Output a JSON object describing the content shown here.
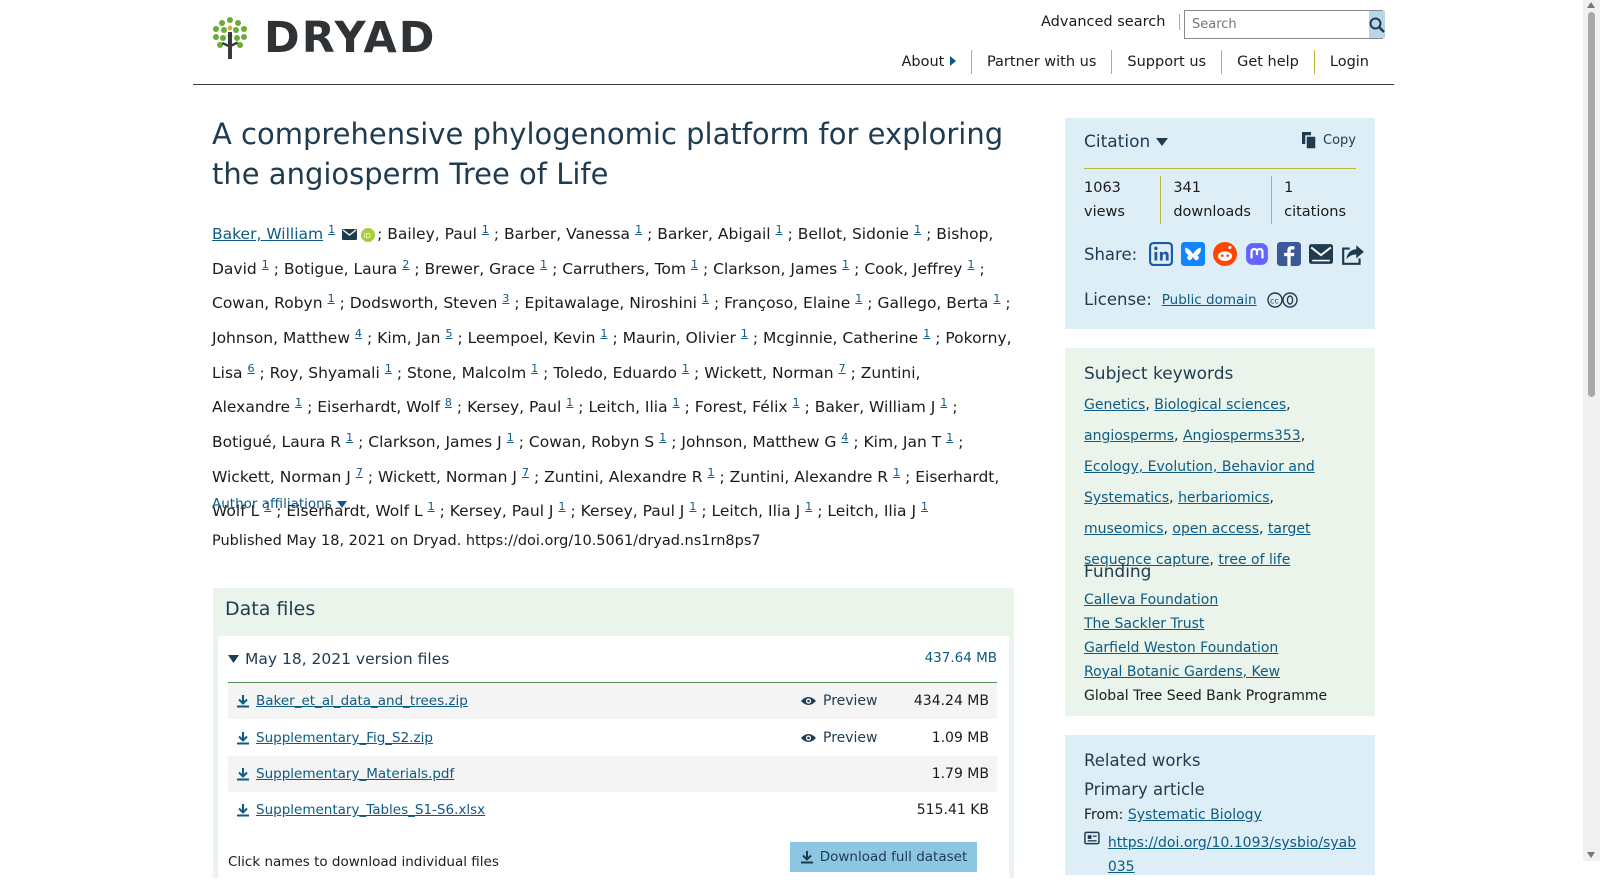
{
  "header": {
    "logo_text": "DRYAD",
    "advanced_search": "Advanced search",
    "search_placeholder": "Search",
    "nav": [
      "About",
      "Partner with us",
      "Support us",
      "Get help",
      "Login"
    ]
  },
  "dataset": {
    "title": "A comprehensive phylogenomic platform for exploring the angiosperm Tree of Life",
    "authors": [
      {
        "name": "Baker, William",
        "aff": "1"
      },
      {
        "name": "Bailey, Paul",
        "aff": "1"
      },
      {
        "name": "Barber, Vanessa",
        "aff": "1"
      },
      {
        "name": "Barker, Abigail",
        "aff": "1"
      },
      {
        "name": "Bellot, Sidonie",
        "aff": "1"
      },
      {
        "name": "Bishop, David",
        "aff": "1"
      },
      {
        "name": "Botigue, Laura",
        "aff": "2"
      },
      {
        "name": "Brewer, Grace",
        "aff": "1"
      },
      {
        "name": "Carruthers, Tom",
        "aff": "1"
      },
      {
        "name": "Clarkson, James",
        "aff": "1"
      },
      {
        "name": "Cook, Jeffrey",
        "aff": "1"
      },
      {
        "name": "Cowan, Robyn",
        "aff": "1"
      },
      {
        "name": "Dodsworth, Steven",
        "aff": "3"
      },
      {
        "name": "Epitawalage, Niroshini",
        "aff": "1"
      },
      {
        "name": "Françoso, Elaine",
        "aff": "1"
      },
      {
        "name": "Gallego, Berta",
        "aff": "1"
      },
      {
        "name": "Johnson, Matthew",
        "aff": "4"
      },
      {
        "name": "Kim, Jan",
        "aff": "5"
      },
      {
        "name": "Leempoel, Kevin",
        "aff": "1"
      },
      {
        "name": "Maurin, Olivier",
        "aff": "1"
      },
      {
        "name": "Mcginnie, Catherine",
        "aff": "1"
      },
      {
        "name": "Pokorny, Lisa",
        "aff": "6"
      },
      {
        "name": "Roy, Shyamali",
        "aff": "1"
      },
      {
        "name": "Stone, Malcolm",
        "aff": "1"
      },
      {
        "name": "Toledo, Eduardo",
        "aff": "1"
      },
      {
        "name": "Wickett, Norman",
        "aff": "7"
      },
      {
        "name": "Zuntini, Alexandre",
        "aff": "1"
      },
      {
        "name": "Eiserhardt, Wolf",
        "aff": "8"
      },
      {
        "name": "Kersey, Paul",
        "aff": "1"
      },
      {
        "name": "Leitch, Ilia",
        "aff": "1"
      },
      {
        "name": "Forest, Félix",
        "aff": "1"
      },
      {
        "name": "Baker, William J",
        "aff": "1"
      },
      {
        "name": "Botigué, Laura R",
        "aff": "1"
      },
      {
        "name": "Clarkson, James J",
        "aff": "1"
      },
      {
        "name": "Cowan, Robyn S",
        "aff": "1"
      },
      {
        "name": "Johnson, Matthew G",
        "aff": "4"
      },
      {
        "name": "Kim, Jan T",
        "aff": "1"
      },
      {
        "name": "Wickett, Norman J",
        "aff": "7"
      },
      {
        "name": "Wickett, Norman J",
        "aff": "7"
      },
      {
        "name": "Zuntini, Alexandre R",
        "aff": "1"
      },
      {
        "name": "Zuntini, Alexandre R",
        "aff": "1"
      },
      {
        "name": "Eiserhardt, Wolf L",
        "aff": "1"
      },
      {
        "name": "Eiserhardt, Wolf L",
        "aff": "1"
      },
      {
        "name": "Kersey, Paul J",
        "aff": "1"
      },
      {
        "name": "Kersey, Paul J",
        "aff": "1"
      },
      {
        "name": "Leitch, Ilia J",
        "aff": "1"
      },
      {
        "name": "Leitch, Ilia J",
        "aff": "1"
      }
    ],
    "author_affiliations": "Author affiliations",
    "published": "Published May 18, 2021 on Dryad. https://doi.org/10.5061/dryad.ns1rn8ps7"
  },
  "data_files": {
    "title": "Data files",
    "version_label": "May 18, 2021 version files",
    "version_size": "437.64 MB",
    "preview_label": "Preview",
    "files": [
      {
        "name": "Baker_et_al_data_and_trees.zip",
        "size": "434.24 MB",
        "preview": true
      },
      {
        "name": "Supplementary_Fig_S2.zip",
        "size": "1.09 MB",
        "preview": true
      },
      {
        "name": "Supplementary_Materials.pdf",
        "size": "1.79 MB",
        "preview": false
      },
      {
        "name": "Supplementary_Tables_S1-S6.xlsx",
        "size": "515.41 KB",
        "preview": false
      }
    ],
    "click_names": "Click names to download individual files",
    "download_full": "Download full dataset"
  },
  "citation": {
    "title": "Citation",
    "copy": "Copy",
    "metrics": [
      {
        "value": "1063",
        "label": "views"
      },
      {
        "value": "341",
        "label": "downloads"
      },
      {
        "value": "1",
        "label": "citations"
      }
    ],
    "share_label": "Share:",
    "share_icons": [
      "linkedin-icon",
      "bluesky-icon",
      "reddit-icon",
      "mastodon-icon",
      "facebook-icon",
      "email-icon",
      "share-icon"
    ],
    "license_label": "License:",
    "license_value": "Public domain"
  },
  "keywords": {
    "title": "Subject keywords",
    "items": [
      "Genetics",
      "Biological sciences",
      "angiosperms",
      "Angiosperms353",
      "Ecology, Evolution, Behavior and Systematics",
      "herbariomics",
      "museomics",
      "open access",
      "target sequence capture",
      "tree of life"
    ]
  },
  "funding": {
    "title": "Funding",
    "links": [
      "Calleva Foundation",
      "The Sackler Trust",
      "Garfield Weston Foundation",
      "Royal Botanic Gardens, Kew"
    ],
    "plain": "Global Tree Seed Bank Programme"
  },
  "related": {
    "title": "Related works",
    "subtitle": "Primary article",
    "from_label": "From:",
    "from_link": "Systematic Biology",
    "doi": "https://doi.org/10.1093/sysbio/syab035"
  },
  "colors": {
    "link": "#0d5b83",
    "heading": "#1f3b50",
    "citation_bg": "#ddeef6",
    "keywords_bg": "#eaf4ea",
    "divider": "#c4b63c"
  }
}
